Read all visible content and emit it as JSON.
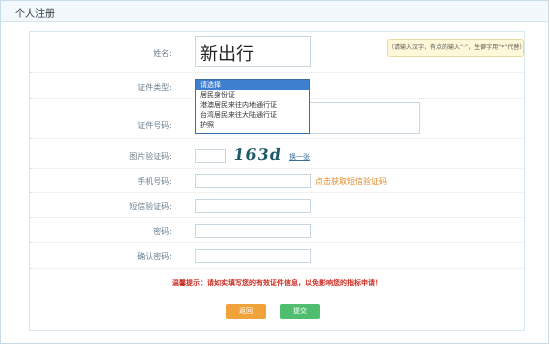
{
  "header": {
    "title": "个人注册"
  },
  "form": {
    "name": {
      "label": "姓名:",
      "value": "新出行",
      "hint": "（请输入汉字，有点的输入“·”，生僻字用“*”代替）"
    },
    "id_type": {
      "label": "证件类型:",
      "options": [
        "请选择",
        "居民身份证",
        "港澳居民来往内地通行证",
        "台湾居民来往大陆通行证",
        "护照"
      ],
      "selected_index": 0
    },
    "id_number": {
      "label": "证件号码:"
    },
    "captcha": {
      "label": "图片验证码:",
      "image_text": "163d",
      "refresh": "换一张"
    },
    "phone": {
      "label": "手机号码:",
      "sms_link": "点击获取短信验证码"
    },
    "sms_code": {
      "label": "短信验证码:"
    },
    "password": {
      "label": "密码:"
    },
    "confirm_password": {
      "label": "确认密码:"
    },
    "tip": "温馨提示：请如实填写您的有效证件信息，以免影响您的指标申请！",
    "buttons": {
      "back": "返回",
      "submit": "提交"
    }
  },
  "colors": {
    "accent": "#3f7fd0",
    "tip": "#cc2a1f",
    "back": "#f2a23b",
    "submit": "#4fbf6f",
    "link": "#e08b2a"
  }
}
